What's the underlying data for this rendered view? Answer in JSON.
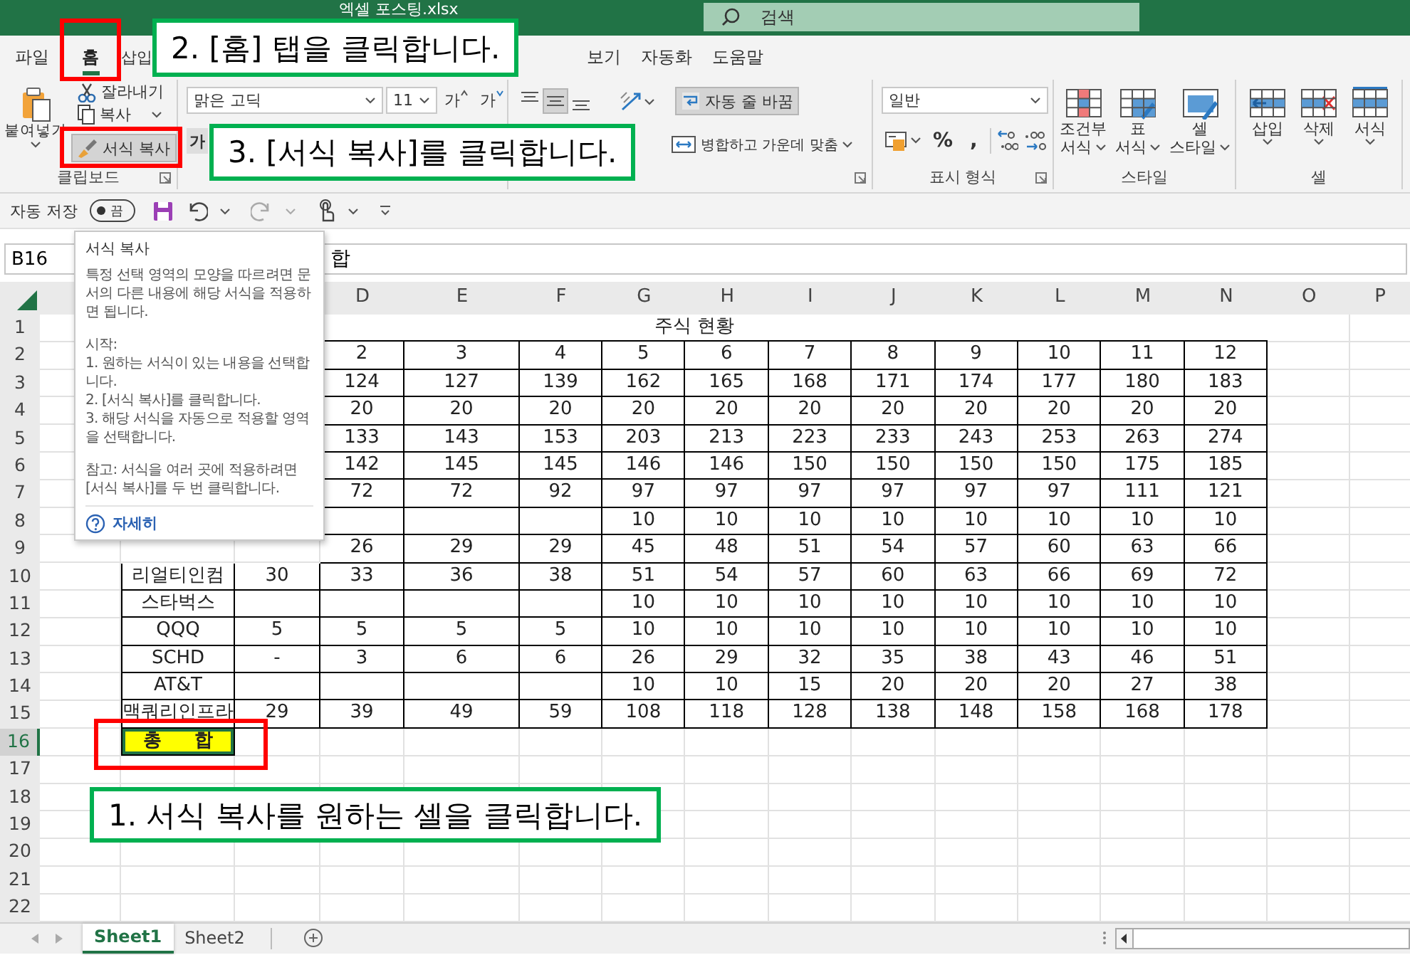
{
  "title_bar": {
    "file_name": "엑셀 포스팅.xlsx",
    "search_placeholder": "검색"
  },
  "tabs": [
    {
      "label": "파일",
      "selected": false
    },
    {
      "label": "홈",
      "selected": true
    },
    {
      "label": "삽입",
      "selected": false
    },
    {
      "label": "보기",
      "selected": false
    },
    {
      "label": "자동화",
      "selected": false
    },
    {
      "label": "도움말",
      "selected": false
    }
  ],
  "ribbon": {
    "clipboard": {
      "paste": "붙여넣기",
      "cut": "잘라내기",
      "copy": "복사",
      "format_painter": {
        "label": "서식 복사",
        "pressed": true
      },
      "group_label": "클립보드"
    },
    "font": {
      "font_name": "맑은 고딕",
      "font_size": "11",
      "grow": "가",
      "shrink": "가",
      "bold": "가"
    },
    "alignment": {
      "vertical_align": [
        {
          "selected": false
        },
        {
          "selected": true
        },
        {
          "selected": false
        }
      ],
      "wrap_text": {
        "label": "자동 줄 바꿈",
        "pressed": true
      },
      "merge": "병합하고 가운데 맞춤"
    },
    "number": {
      "format": "일반",
      "percent": "%",
      "comma": ",",
      "group_label": "표시 형식"
    },
    "styles": {
      "items": [
        {
          "line1": "조건부",
          "line2": "서식"
        },
        {
          "line1": "표",
          "line2": "서식"
        },
        {
          "line1": "셀",
          "line2": "스타일"
        }
      ],
      "group_label": "스타일"
    },
    "cells": {
      "items": [
        "삽입",
        "삭제",
        "서식"
      ],
      "group_label": "셀"
    }
  },
  "quick_access": {
    "autosave_label": "자동 저장",
    "autosave_on": false,
    "autosave_state": "끔"
  },
  "formula_bar": {
    "name_box": "B16",
    "content": "합"
  },
  "sheet": {
    "column_headers": [
      "D",
      "E",
      "F",
      "G",
      "H",
      "I",
      "J",
      "K",
      "L",
      "M",
      "N",
      "O",
      "P"
    ],
    "row_headers": [
      "1",
      "2",
      "3",
      "4",
      "5",
      "6",
      "7",
      "8",
      "9",
      "10",
      "11",
      "12",
      "13",
      "14",
      "15",
      "16",
      "17",
      "18",
      "19",
      "20",
      "21",
      "22"
    ],
    "title": "주식 현황",
    "rows": [
      {
        "cells": [
          "2",
          "3",
          "4",
          "5",
          "6",
          "7",
          "8",
          "9",
          "10",
          "11",
          "12"
        ]
      },
      {
        "cells": [
          "124",
          "127",
          "139",
          "162",
          "165",
          "168",
          "171",
          "174",
          "177",
          "180",
          "183"
        ]
      },
      {
        "cells": [
          "20",
          "20",
          "20",
          "20",
          "20",
          "20",
          "20",
          "20",
          "20",
          "20",
          "20"
        ]
      },
      {
        "cells": [
          "133",
          "143",
          "153",
          "203",
          "213",
          "223",
          "233",
          "243",
          "253",
          "263",
          "274"
        ]
      },
      {
        "cells": [
          "142",
          "145",
          "145",
          "146",
          "146",
          "150",
          "150",
          "150",
          "150",
          "175",
          "185"
        ]
      },
      {
        "cells": [
          "72",
          "72",
          "92",
          "97",
          "97",
          "97",
          "97",
          "97",
          "97",
          "111",
          "121"
        ]
      },
      {
        "cells": [
          null,
          null,
          null,
          "10",
          "10",
          "10",
          "10",
          "10",
          "10",
          "10",
          "10"
        ]
      },
      {
        "cells": [
          "26",
          "29",
          "29",
          "45",
          "48",
          "51",
          "54",
          "57",
          "60",
          "63",
          "66"
        ]
      },
      {
        "name": "리얼티인컴",
        "column_c": "30",
        "cells": [
          "33",
          "36",
          "38",
          "51",
          "54",
          "57",
          "60",
          "63",
          "66",
          "69",
          "72"
        ]
      },
      {
        "name": "스타벅스",
        "cells": [
          null,
          null,
          null,
          "10",
          "10",
          "10",
          "10",
          "10",
          "10",
          "10",
          "10"
        ]
      },
      {
        "name": "QQQ",
        "column_c": "5",
        "cells": [
          "5",
          "5",
          "5",
          "10",
          "10",
          "10",
          "10",
          "10",
          "10",
          "10",
          "10"
        ]
      },
      {
        "name": "SCHD",
        "column_c": "-",
        "cells": [
          "3",
          "6",
          "6",
          "26",
          "29",
          "32",
          "35",
          "38",
          "43",
          "46",
          "51"
        ]
      },
      {
        "name": "AT&T",
        "cells": [
          null,
          null,
          null,
          "10",
          "10",
          "15",
          "20",
          "20",
          "20",
          "27",
          "38"
        ]
      },
      {
        "name": "맥쿼리인프라",
        "column_c": "29",
        "cells": [
          "39",
          "49",
          "59",
          "108",
          "118",
          "128",
          "138",
          "148",
          "158",
          "168",
          "178"
        ]
      }
    ],
    "total": {
      "label": "총 합",
      "selected": true
    }
  },
  "sheet_tabs": [
    {
      "label": "Sheet1",
      "selected": true
    },
    {
      "label": "Sheet2",
      "selected": false
    }
  ],
  "tooltip": {
    "title": "서식 복사",
    "description": "특정 선택 영역의 모양을 따르려면 문서의 다른 내용에 해당 서식을 적용하면 됩니다.",
    "steps_heading": "시작:",
    "steps": [
      "1. 원하는 서식이 있는 내용을 선택합니다.",
      "2. [서식 복사]를 클릭합니다.",
      "3. 해당 서식을 자동으로 적용할 영역을 선택합니다."
    ],
    "note": "참고: 서식을 여러 곳에 적용하려면 [서식 복사]를 두 번 클릭합니다.",
    "link": "자세히"
  },
  "callouts": [
    {
      "text": "2. [홈] 탭을 클릭합니다."
    },
    {
      "text": "3. [서식 복사]를 클릭합니다."
    },
    {
      "text": "1. 서식 복사를 원하는 셀을 클릭합니다."
    }
  ]
}
